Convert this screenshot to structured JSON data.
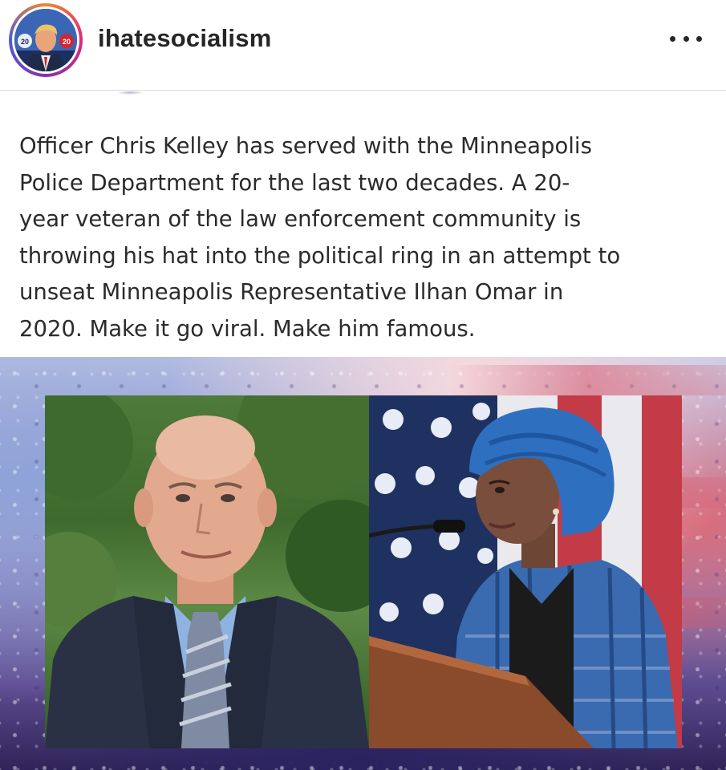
{
  "post": {
    "username": "ihatesocialism",
    "more_icon": "more-horizontal-icon",
    "avatar_badge_left": "20",
    "avatar_badge_right": "20"
  },
  "caption": {
    "text": "Officer Chris Kelley has served with the Minneapolis\nPolice Department for the last two decades.  A 20-\nyear veteran of the law enforcement community is\nthrowing his hat into the political ring in an attempt to\nunseat Minneapolis Representative Ilhan Omar in\n2020. Make it go viral. Make him famous."
  },
  "colors": {
    "text": "#262626",
    "divider": "#dbdbdb",
    "ring_gradient": [
      "#f58529",
      "#dd2a7b",
      "#8134af",
      "#515bd4"
    ]
  }
}
